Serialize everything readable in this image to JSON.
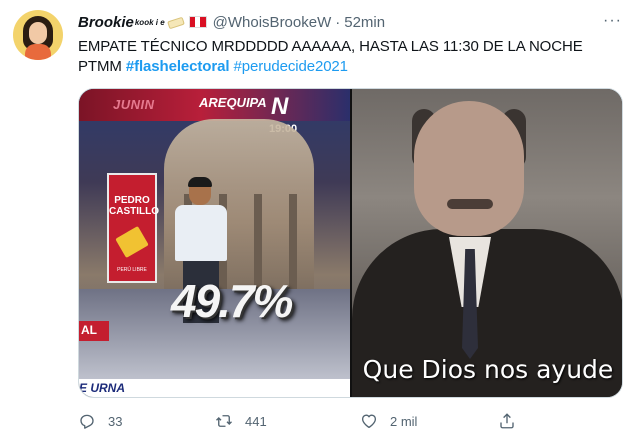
{
  "tweet": {
    "display_name": "Brookie",
    "name_suffix": "kook i e",
    "handle": "@WhoisBrookeW",
    "separator": "·",
    "time": "52min",
    "more": "···",
    "text_main": "EMPATE TÉCNICO MRDDDDD AAAAAA, HASTA LAS 11:30 DE LA NOCHE PTMM",
    "hashtag_1": "#flashelectoral",
    "hashtag_2": "#perudecide2021"
  },
  "media": {
    "left": {
      "junin": "JUNIN",
      "arequipa": "AREQUIPA",
      "logo": "N",
      "clock": "19:00",
      "card_name": "PEDRO CASTILLO",
      "card_foot": "PERÚ LIBRE",
      "percent": "49.7%",
      "side_tab": "AL",
      "bottom_label": "E URNA"
    },
    "right": {
      "caption": "Que Dios nos ayude"
    }
  },
  "actions": {
    "replies": "33",
    "retweets": "441",
    "likes": "2 mil"
  },
  "colors": {
    "link": "#1d9bf0",
    "muted": "#536471"
  }
}
